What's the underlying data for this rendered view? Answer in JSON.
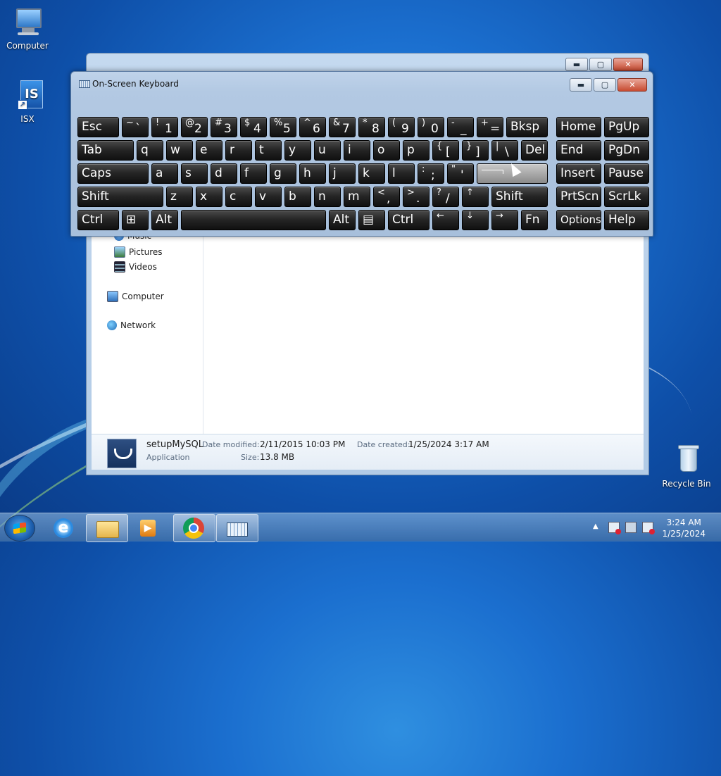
{
  "desktop": {
    "icons": [
      {
        "label": "Computer"
      },
      {
        "label": "ISX"
      },
      {
        "label": "Recycle Bin"
      }
    ]
  },
  "explorer": {
    "nav_items": [
      {
        "label": "Music"
      },
      {
        "label": "Pictures"
      },
      {
        "label": "Videos"
      },
      {
        "label": "Computer"
      },
      {
        "label": "Network"
      }
    ],
    "details": {
      "name": "setupMySQL",
      "type": "Application",
      "modified_label": "Date modified:",
      "modified_value": "2/11/2015 10:03 PM",
      "created_label": "Date created:",
      "created_value": "1/25/2024 3:17 AM",
      "size_label": "Size:",
      "size_value": "13.8 MB"
    }
  },
  "osk": {
    "title": "On-Screen Keyboard",
    "rows": [
      [
        {
          "label": "Esc",
          "w": 59
        },
        {
          "shift": "~",
          "main": "`",
          "w": 38
        },
        {
          "shift": "!",
          "main": "1",
          "w": 38
        },
        {
          "shift": "@",
          "main": "2",
          "w": 38
        },
        {
          "shift": "#",
          "main": "3",
          "w": 38
        },
        {
          "shift": "$",
          "main": "4",
          "w": 38
        },
        {
          "shift": "%",
          "main": "5",
          "w": 38
        },
        {
          "shift": "^",
          "main": "6",
          "w": 38
        },
        {
          "shift": "&",
          "main": "7",
          "w": 38
        },
        {
          "shift": "*",
          "main": "8",
          "w": 38
        },
        {
          "shift": "(",
          "main": "9",
          "w": 38
        },
        {
          "shift": ")",
          "main": "0",
          "w": 38
        },
        {
          "shift": "-",
          "main": "_",
          "w": 38
        },
        {
          "shift": "+",
          "main": "=",
          "w": 38
        },
        {
          "label": "Bksp",
          "w": 59
        },
        {
          "label": "Home",
          "w": 64,
          "gap": 8
        },
        {
          "label": "PgUp",
          "w": 64
        }
      ],
      [
        {
          "label": "Tab",
          "w": 80
        },
        {
          "label": "q",
          "w": 38
        },
        {
          "label": "w",
          "w": 38
        },
        {
          "label": "e",
          "w": 38
        },
        {
          "label": "r",
          "w": 38
        },
        {
          "label": "t",
          "w": 38
        },
        {
          "label": "y",
          "w": 38
        },
        {
          "label": "u",
          "w": 38
        },
        {
          "label": "i",
          "w": 38
        },
        {
          "label": "o",
          "w": 38
        },
        {
          "label": "p",
          "w": 38
        },
        {
          "shift": "{",
          "main": "[",
          "w": 38
        },
        {
          "shift": "}",
          "main": "]",
          "w": 38
        },
        {
          "shift": "|",
          "main": "\\",
          "w": 38
        },
        {
          "label": "Del",
          "w": 38
        },
        {
          "label": "End",
          "w": 64,
          "gap": 8
        },
        {
          "label": "PgDn",
          "w": 64
        }
      ],
      [
        {
          "label": "Caps",
          "w": 101
        },
        {
          "label": "a",
          "w": 38
        },
        {
          "label": "s",
          "w": 38
        },
        {
          "label": "d",
          "w": 38
        },
        {
          "label": "f",
          "w": 38
        },
        {
          "label": "g",
          "w": 38
        },
        {
          "label": "h",
          "w": 38
        },
        {
          "label": "j",
          "w": 38
        },
        {
          "label": "k",
          "w": 38
        },
        {
          "label": "l",
          "w": 38
        },
        {
          "shift": ":",
          "main": ";",
          "w": 38
        },
        {
          "shift": "\"",
          "main": "'",
          "w": 38
        },
        {
          "label": "",
          "w": 101,
          "pressed": true
        },
        {
          "label": "Insert",
          "w": 64,
          "gap": 8
        },
        {
          "label": "Pause",
          "w": 64
        }
      ],
      [
        {
          "label": "Shift",
          "w": 122
        },
        {
          "label": "z",
          "w": 38
        },
        {
          "label": "x",
          "w": 38
        },
        {
          "label": "c",
          "w": 38
        },
        {
          "label": "v",
          "w": 38
        },
        {
          "label": "b",
          "w": 38
        },
        {
          "label": "n",
          "w": 38
        },
        {
          "label": "m",
          "w": 38
        },
        {
          "shift": "<",
          "main": ",",
          "w": 38
        },
        {
          "shift": ">",
          "main": ".",
          "w": 38
        },
        {
          "shift": "?",
          "main": "/",
          "w": 38
        },
        {
          "shift": "↑",
          "main": "",
          "w": 38
        },
        {
          "label": "Shift",
          "w": 80
        },
        {
          "label": "PrtScn",
          "w": 64,
          "gap": 8
        },
        {
          "label": "ScrLk",
          "w": 64
        }
      ],
      [
        {
          "label": "Ctrl",
          "w": 59
        },
        {
          "label": "⊞",
          "w": 38
        },
        {
          "label": "Alt",
          "w": 38
        },
        {
          "label": "",
          "w": 206
        },
        {
          "label": "Alt",
          "w": 38
        },
        {
          "label": "▤",
          "w": 38
        },
        {
          "label": "Ctrl",
          "w": 59
        },
        {
          "shift": "←",
          "main": "",
          "w": 38
        },
        {
          "shift": "↓",
          "main": "",
          "w": 38
        },
        {
          "shift": "→",
          "main": "",
          "w": 38
        },
        {
          "label": "Fn",
          "w": 38
        },
        {
          "label": "Options",
          "w": 64,
          "gap": 8,
          "small": true
        },
        {
          "label": "Help",
          "w": 64
        }
      ]
    ]
  },
  "taskbar": {
    "time": "3:24 AM",
    "date": "1/25/2024",
    "pinned": [
      "internet-explorer",
      "windows-explorer",
      "media-player",
      "chrome",
      "on-screen-keyboard"
    ]
  }
}
